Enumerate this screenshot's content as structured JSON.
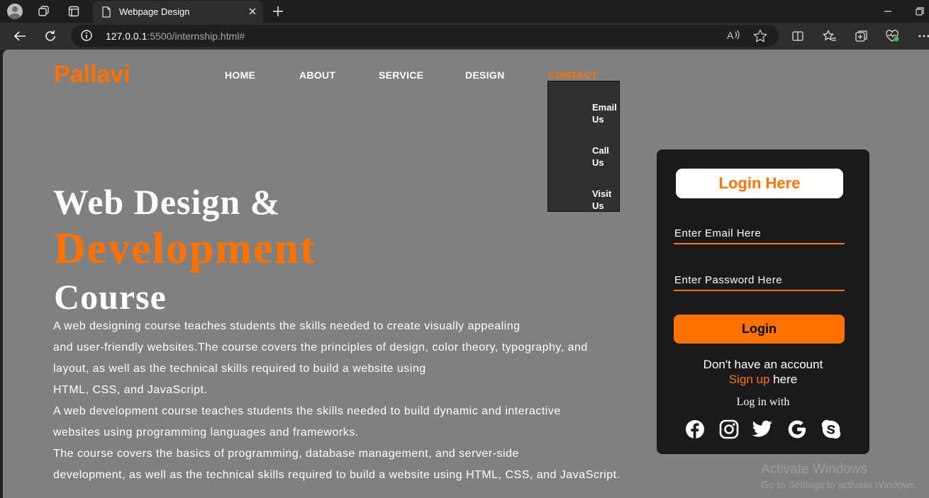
{
  "browser": {
    "tab_title": "Webpage Design",
    "url_host": "127.0.0.1",
    "url_rest": ":5500/internship.html#"
  },
  "site": {
    "logo": "Pallavi",
    "nav": [
      "HOME",
      "ABOUT",
      "SERVICE",
      "DESIGN",
      "CONTACT"
    ],
    "contact_menu": [
      "Email Us",
      "Call Us",
      "Visit Us"
    ]
  },
  "hero": {
    "line1": "Web Design &",
    "line2": "Development",
    "line3": "Course",
    "description": [
      "A web designing course teaches students the skills needed to create visually appealing",
      "and user-friendly websites.The course covers the principles of design, color theory, typography, and",
      "layout, as well as the technical skills required to build a website using",
      "HTML, CSS, and JavaScript.",
      "A web development course teaches students the skills needed to build dynamic and interactive",
      "websites using programming languages and frameworks.",
      "The course covers the basics of programming, database management, and server-side",
      "development, as well as the technical skills required to build a website using HTML, CSS, and JavaScript."
    ]
  },
  "login": {
    "heading": "Login Here",
    "email_placeholder": "Enter Email Here",
    "password_placeholder": "Enter Password Here",
    "button": "Login",
    "no_account": "Don't have an account",
    "signup_link": "Sign up",
    "signup_suffix": " here",
    "login_with": "Log in with",
    "socials": [
      "facebook-icon",
      "instagram-icon",
      "twitter-icon",
      "google-icon",
      "skype-icon"
    ]
  },
  "watermark": {
    "title": "Activate Windows",
    "subtitle": "Go to Settings to activate Windows."
  },
  "colors": {
    "accent": "#ff7200",
    "page_bg": "#808080",
    "card_bg": "#1a1a1a"
  }
}
